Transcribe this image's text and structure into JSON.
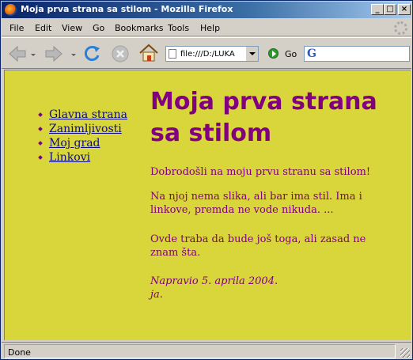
{
  "window": {
    "title": "Moja prva strana sa stilom - Mozilla Firefox",
    "buttons": {
      "minimize": "_",
      "maximize": "□",
      "close": "×"
    }
  },
  "menubar": {
    "items": [
      "File",
      "Edit",
      "View",
      "Go",
      "Bookmarks",
      "Tools",
      "Help"
    ]
  },
  "toolbar": {
    "icons": [
      "back-icon",
      "forward-icon",
      "reload-icon",
      "stop-icon",
      "home-icon"
    ],
    "url_value": "file:///D:/LUKA",
    "go_label": "Go",
    "search_engine_icon": "google-icon",
    "search_value": ""
  },
  "page": {
    "background": "#d8d63a",
    "text_color": "#800080",
    "link_color": "#0c0c80",
    "nav_links": [
      "Glavna strana",
      "Zanimljivosti",
      "Moj grad",
      "Linkovi"
    ],
    "heading": "Moja prva strana sa stilom",
    "paragraphs": [
      "Dobrodošli na moju prvu stranu sa stilom!",
      "Na njoj nema slika, ali bar ima stil. Ima i linkove, premda ne vode nikuda. ...",
      "Ovde traba da bude još toga, ali zasad ne znam šta."
    ],
    "signature_line1": "Napravio 5. aprila 2004.",
    "signature_line2": "ja."
  },
  "status": {
    "text": "Done"
  }
}
